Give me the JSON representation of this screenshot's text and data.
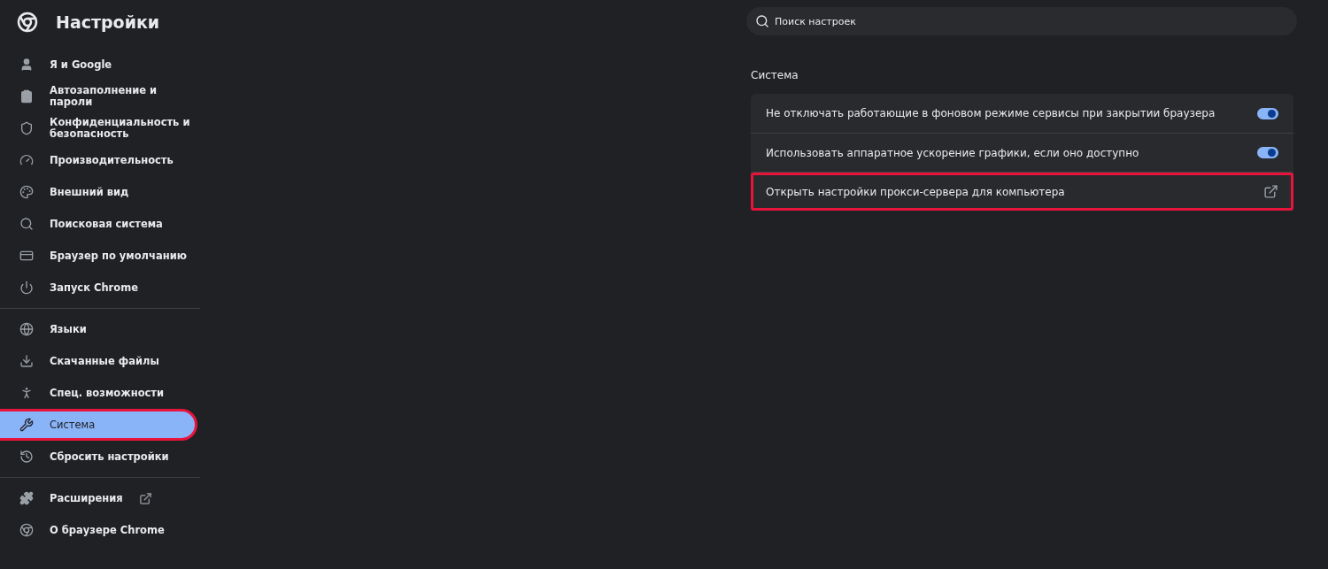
{
  "header": {
    "title": "Настройки"
  },
  "sidebar": {
    "groups": [
      [
        {
          "label": "Я и Google",
          "selected": false,
          "highlighted": false,
          "external": false
        },
        {
          "label": "Автозаполнение и пароли",
          "selected": false,
          "highlighted": false,
          "external": false
        },
        {
          "label": "Конфиденциальность и безопасность",
          "selected": false,
          "highlighted": false,
          "external": false
        },
        {
          "label": "Производительность",
          "selected": false,
          "highlighted": false,
          "external": false
        },
        {
          "label": "Внешний вид",
          "selected": false,
          "highlighted": false,
          "external": false
        },
        {
          "label": "Поисковая система",
          "selected": false,
          "highlighted": false,
          "external": false
        },
        {
          "label": "Браузер по умолчанию",
          "selected": false,
          "highlighted": false,
          "external": false
        },
        {
          "label": "Запуск Chrome",
          "selected": false,
          "highlighted": false,
          "external": false
        }
      ],
      [
        {
          "label": "Языки",
          "selected": false,
          "highlighted": false,
          "external": false
        },
        {
          "label": "Скачанные файлы",
          "selected": false,
          "highlighted": false,
          "external": false
        },
        {
          "label": "Спец. возможности",
          "selected": false,
          "highlighted": false,
          "external": false
        },
        {
          "label": "Система",
          "selected": true,
          "highlighted": true,
          "external": false
        },
        {
          "label": "Сбросить настройки",
          "selected": false,
          "highlighted": false,
          "external": false
        }
      ],
      [
        {
          "label": "Расширения",
          "selected": false,
          "highlighted": false,
          "external": true
        },
        {
          "label": "О браузере Chrome",
          "selected": false,
          "highlighted": false,
          "external": false
        }
      ]
    ]
  },
  "search": {
    "placeholder": "Поиск настроек"
  },
  "section": {
    "title": "Система",
    "rows": [
      {
        "kind": "toggle",
        "label": "Не отключать работающие в фоновом режиме сервисы при закрытии браузера",
        "on": true,
        "highlighted": false
      },
      {
        "kind": "toggle",
        "label": "Использовать аппаратное ускорение графики, если оно доступно",
        "on": true,
        "highlighted": false
      },
      {
        "kind": "link",
        "label": "Открыть настройки прокси-сервера для компьютера",
        "highlighted": true
      }
    ]
  }
}
